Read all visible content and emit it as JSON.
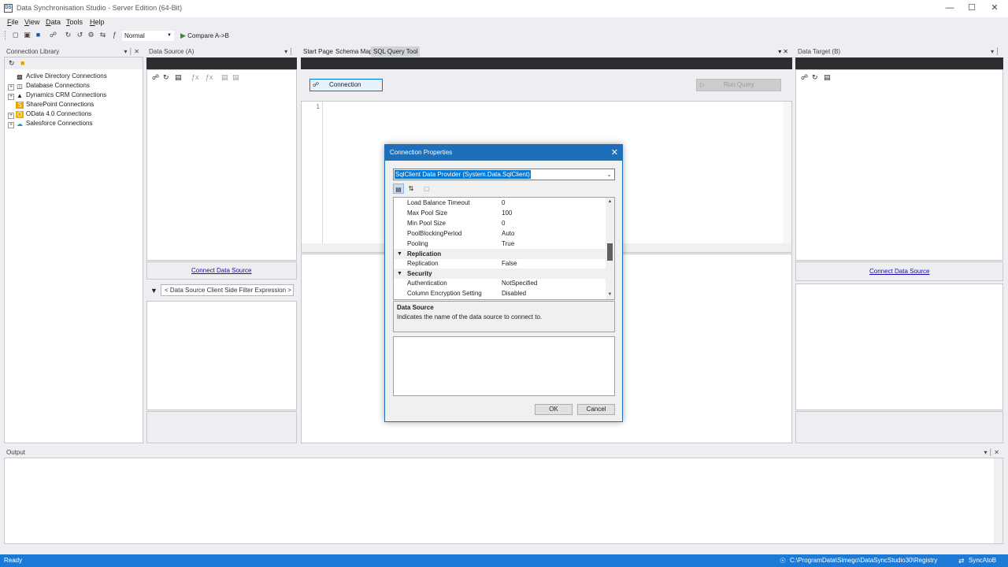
{
  "window": {
    "app_icon": "DS",
    "title": "Data Synchronisation Studio - Server Edition (64-Bit)",
    "minimize": "—",
    "maximize": "☐",
    "close": "✕"
  },
  "menu": {
    "items": [
      {
        "first": "F",
        "rest": "ile"
      },
      {
        "first": "V",
        "rest": "iew"
      },
      {
        "first": "D",
        "rest": "ata"
      },
      {
        "first": "T",
        "rest": "ools"
      },
      {
        "first": "H",
        "rest": "elp"
      }
    ]
  },
  "toolbar": {
    "mode_value": "Normal",
    "compare_label": "Compare A->B"
  },
  "connection_library": {
    "title": "Connection Library",
    "items": [
      {
        "label": "Active Directory Connections",
        "icon": "active-directory-icon"
      },
      {
        "label": "Database Connections",
        "icon": "database-icon"
      },
      {
        "label": "Dynamics CRM Connections",
        "icon": "dynamics-crm-icon"
      },
      {
        "label": "SharePoint Connections",
        "icon": "sharepoint-icon"
      },
      {
        "label": "OData 4.0 Connections",
        "icon": "odata-icon"
      },
      {
        "label": "Salesforce Connections",
        "icon": "salesforce-icon"
      }
    ]
  },
  "data_source": {
    "title": "Data Source (A)",
    "connect_link": "Connect Data Source",
    "filter_placeholder": "< Data Source Client Side Filter Expression >"
  },
  "center": {
    "tabs": [
      {
        "label": "Start Page"
      },
      {
        "label": "Schema Map"
      },
      {
        "label": "SQL Query Tool"
      }
    ],
    "connection_button": "Connection",
    "run_query_button": "Run Query",
    "line_number": "1"
  },
  "data_target": {
    "title": "Data Target (B)",
    "connect_link": "Connect Data Source"
  },
  "output": {
    "title": "Output"
  },
  "dialog": {
    "title": "Connection Properties",
    "provider": "SqlClient Data Provider (System.Data.SqlClient)",
    "properties": [
      {
        "key": "Load Balance Timeout",
        "value": "0"
      },
      {
        "key": "Max Pool Size",
        "value": "100"
      },
      {
        "key": "Min Pool Size",
        "value": "0"
      },
      {
        "key": "PoolBlockingPeriod",
        "value": "Auto"
      },
      {
        "key": "Pooling",
        "value": "True"
      }
    ],
    "category_replication": "Replication",
    "replication_row": {
      "key": "Replication",
      "value": "False"
    },
    "category_security": "Security",
    "security_rows": [
      {
        "key": "Authentication",
        "value": "NotSpecified"
      },
      {
        "key": "Column Encryption Setting",
        "value": "Disabled"
      }
    ],
    "description_title": "Data Source",
    "description_text": "Indicates the name of the data source to connect to.",
    "ok": "OK",
    "cancel": "Cancel"
  },
  "status": {
    "left": "Ready",
    "path": "C:\\ProgramData\\Simego\\DataSyncStudio30\\Registry",
    "sync": "SyncAtoB"
  },
  "colors": {
    "accent": "#1c7ad6",
    "dialog_title": "#1c6fb8",
    "dark_strip": "#2d2d30",
    "link": "#1a0dab"
  }
}
